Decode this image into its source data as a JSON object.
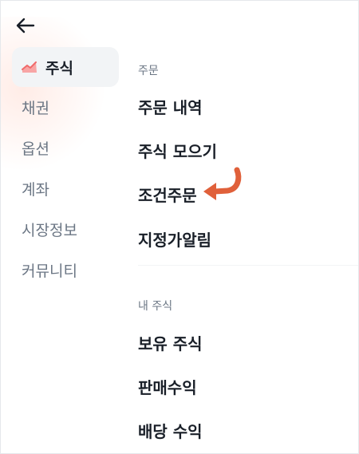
{
  "nav": {
    "back_icon": "arrow-left-icon"
  },
  "sidebar": {
    "items": [
      {
        "label": "주식",
        "active": true,
        "icon": "chart-icon"
      },
      {
        "label": "채권"
      },
      {
        "label": "옵션"
      },
      {
        "label": "계좌"
      },
      {
        "label": "시장정보"
      },
      {
        "label": "커뮤니티"
      }
    ]
  },
  "menu": {
    "sections": [
      {
        "title": "주문",
        "items": [
          "주문 내역",
          "주식 모으기",
          "조건주문",
          "지정가알림"
        ]
      },
      {
        "title": "내 주식",
        "items": [
          "보유 주식",
          "판매수익",
          "배당 수익"
        ]
      }
    ]
  },
  "colors": {
    "accent_arrow": "#e0603a",
    "active_bg": "#f2f4f6",
    "chart_icon": "#f06a6a"
  }
}
